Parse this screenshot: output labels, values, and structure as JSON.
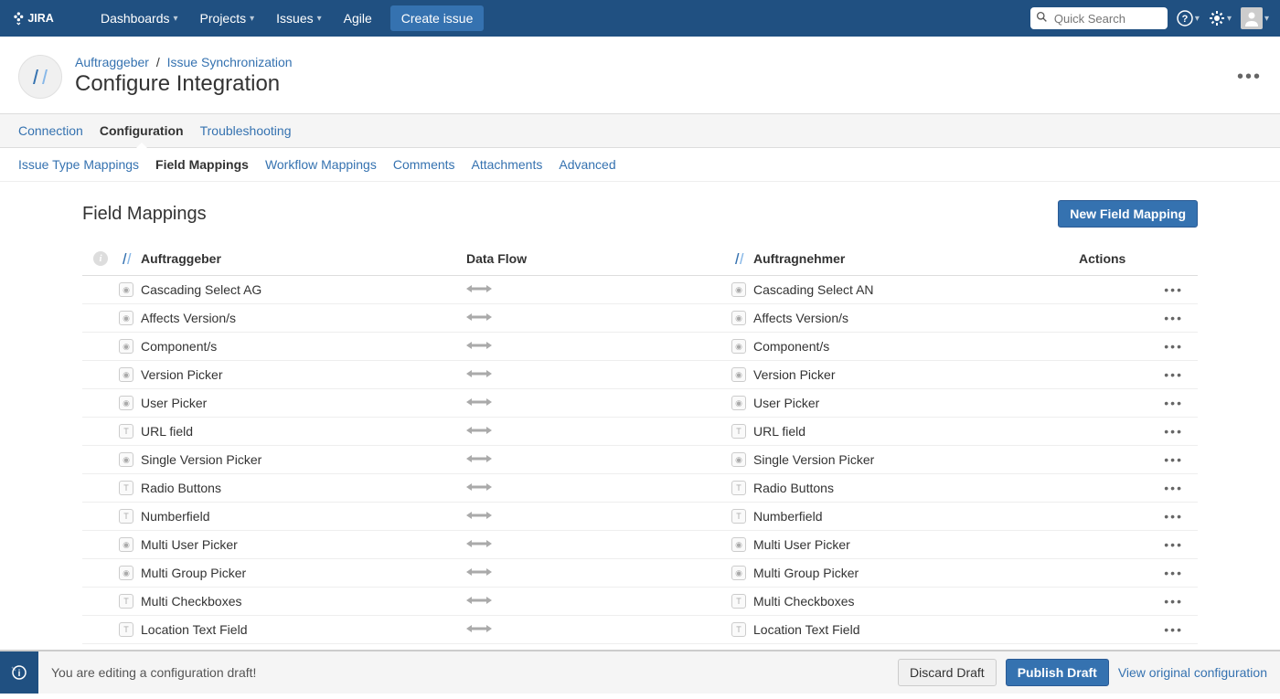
{
  "nav": {
    "items": [
      "Dashboards",
      "Projects",
      "Issues",
      "Agile"
    ],
    "create": "Create issue",
    "search_placeholder": "Quick Search"
  },
  "breadcrumb": {
    "project": "Auftraggeber",
    "section": "Issue Synchronization"
  },
  "page_title": "Configure Integration",
  "tabs_primary": [
    {
      "label": "Connection",
      "active": false
    },
    {
      "label": "Configuration",
      "active": true
    },
    {
      "label": "Troubleshooting",
      "active": false
    }
  ],
  "tabs_secondary": [
    {
      "label": "Issue Type Mappings",
      "active": false
    },
    {
      "label": "Field Mappings",
      "active": true
    },
    {
      "label": "Workflow Mappings",
      "active": false
    },
    {
      "label": "Comments",
      "active": false
    },
    {
      "label": "Attachments",
      "active": false
    },
    {
      "label": "Advanced",
      "active": false
    }
  ],
  "section": {
    "title": "Field Mappings",
    "new_button": "New Field Mapping"
  },
  "columns": {
    "left": "Auftraggeber",
    "flow": "Data Flow",
    "right": "Auftragnehmer",
    "actions": "Actions"
  },
  "rows": [
    {
      "left": "Cascading Select AG",
      "right": "Cascading Select AN",
      "lt": "dot",
      "rt": "dot"
    },
    {
      "left": "Affects Version/s",
      "right": "Affects Version/s",
      "lt": "dot",
      "rt": "dot"
    },
    {
      "left": "Component/s",
      "right": "Component/s",
      "lt": "dot",
      "rt": "dot"
    },
    {
      "left": "Version Picker",
      "right": "Version Picker",
      "lt": "dot",
      "rt": "dot"
    },
    {
      "left": "User Picker",
      "right": "User Picker",
      "lt": "dot",
      "rt": "dot"
    },
    {
      "left": "URL field",
      "right": "URL field",
      "lt": "T",
      "rt": "T"
    },
    {
      "left": "Single Version Picker",
      "right": "Single Version Picker",
      "lt": "dot",
      "rt": "dot"
    },
    {
      "left": "Radio Buttons",
      "right": "Radio Buttons",
      "lt": "T",
      "rt": "T"
    },
    {
      "left": "Numberfield",
      "right": "Numberfield",
      "lt": "T",
      "rt": "T"
    },
    {
      "left": "Multi User Picker",
      "right": "Multi User Picker",
      "lt": "dot",
      "rt": "dot"
    },
    {
      "left": "Multi Group Picker",
      "right": "Multi Group Picker",
      "lt": "dot",
      "rt": "dot"
    },
    {
      "left": "Multi Checkboxes",
      "right": "Multi Checkboxes",
      "lt": "T",
      "rt": "T"
    },
    {
      "left": "Location Text Field",
      "right": "Location Text Field",
      "lt": "T",
      "rt": "T"
    }
  ],
  "footer": {
    "message": "You are editing a configuration draft!",
    "discard": "Discard Draft",
    "publish": "Publish Draft",
    "view_original": "View original configuration"
  }
}
